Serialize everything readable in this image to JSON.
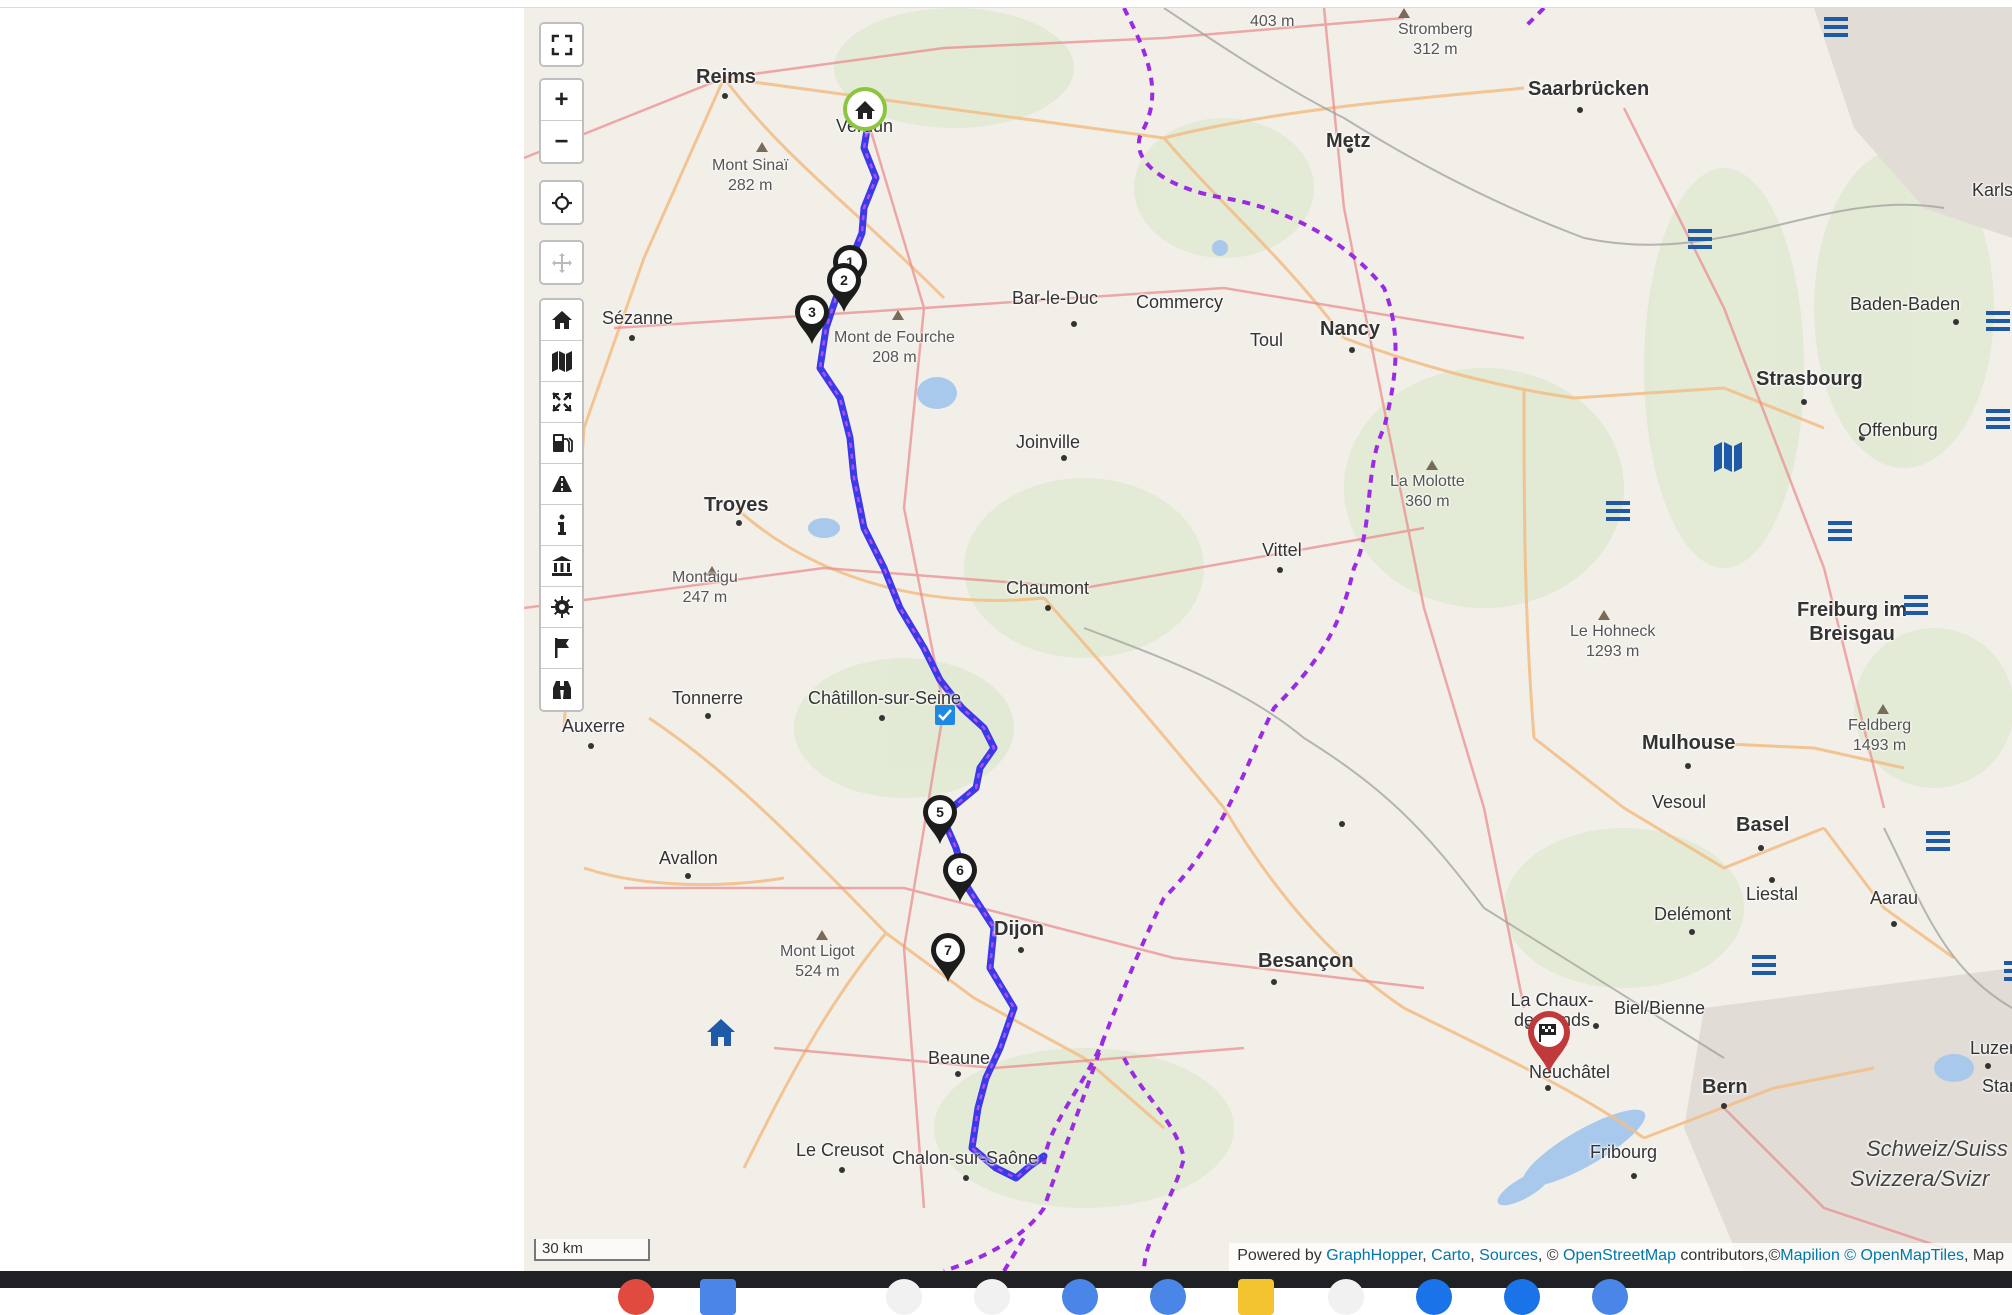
{
  "map": {
    "cities": [
      {
        "name": "Reims",
        "big": true
      },
      {
        "name": "Metz",
        "big": true
      },
      {
        "name": "Saarbrücken",
        "big": true
      },
      {
        "name": "Verdun",
        "big": false
      },
      {
        "name": "Sézanne",
        "big": false
      },
      {
        "name": "Bar-le-Duc",
        "big": false
      },
      {
        "name": "Commercy",
        "big": false
      },
      {
        "name": "Toul",
        "big": false
      },
      {
        "name": "Nancy",
        "big": true
      },
      {
        "name": "Strasbourg",
        "big": true
      },
      {
        "name": "Baden-Baden",
        "big": false
      },
      {
        "name": "Offenburg",
        "big": false
      },
      {
        "name": "Karlsr",
        "big": false
      },
      {
        "name": "Joinville",
        "big": false
      },
      {
        "name": "Troyes",
        "big": true
      },
      {
        "name": "Vittel",
        "big": false
      },
      {
        "name": "Chaumont",
        "big": false
      },
      {
        "name": "Freiburg im Breisgau",
        "big": true
      },
      {
        "name": "Tonnerre",
        "big": false
      },
      {
        "name": "Châtillon-sur-Seine",
        "big": false
      },
      {
        "name": "Auxerre",
        "big": false
      },
      {
        "name": "Mulhouse",
        "big": true
      },
      {
        "name": "Vesoul",
        "big": false
      },
      {
        "name": "Avallon",
        "big": false
      },
      {
        "name": "Basel",
        "big": true
      },
      {
        "name": "Liestal",
        "big": false
      },
      {
        "name": "Delémont",
        "big": false
      },
      {
        "name": "Aarau",
        "big": false
      },
      {
        "name": "Dijon",
        "big": true
      },
      {
        "name": "Besançon",
        "big": true
      },
      {
        "name": "La Chaux-de-Fonds",
        "big": false
      },
      {
        "name": "Biel/Bienne",
        "big": false
      },
      {
        "name": "Beaune",
        "big": false
      },
      {
        "name": "Neuchâtel",
        "big": false
      },
      {
        "name": "Bern",
        "big": true
      },
      {
        "name": "Luzern",
        "big": false
      },
      {
        "name": "Stans",
        "big": false
      },
      {
        "name": "Le Creusot",
        "big": false
      },
      {
        "name": "Chalon-sur-Saône",
        "big": false
      },
      {
        "name": "Fribourg",
        "big": false
      },
      {
        "name": "Schweiz/Suiss",
        "big": false
      },
      {
        "name": "Svizzera/Svizr",
        "big": false
      }
    ],
    "peaks": [
      {
        "name": "Mont Sinaï",
        "elev": "282 m"
      },
      {
        "name": "Mont de Fourche",
        "elev": "208 m"
      },
      {
        "name": "Montaigu",
        "elev": "247 m"
      },
      {
        "name": "La Molotte",
        "elev": "360 m"
      },
      {
        "name": "Le Hohneck",
        "elev": "1293 m"
      },
      {
        "name": "Feldberg",
        "elev": "1493 m"
      },
      {
        "name": "Mont Ligot",
        "elev": "524 m"
      },
      {
        "name": "Stromberg",
        "elev": "312 m"
      },
      {
        "name": "",
        "elev": "403 m"
      }
    ],
    "waypoints": [
      "1",
      "2",
      "3",
      "5",
      "6",
      "7"
    ],
    "route_color": "#3a3ae8",
    "route_dash_color": "#b04ff0",
    "border_color": "#9a2be2"
  },
  "controls": {
    "fullscreen_icon": "fullscreen-icon",
    "zoom_in_label": "+",
    "zoom_out_label": "−",
    "toolbar_icons": [
      "home-icon",
      "map-icon",
      "expand-icon",
      "fuel-icon",
      "road-icon",
      "info-icon",
      "museum-icon",
      "settings-icon",
      "flag-icon",
      "binoculars-icon"
    ]
  },
  "scale": {
    "label": "30 km"
  },
  "attribution": {
    "prefix": "Powered by",
    "graphhopper": "GraphHopper",
    "carto": "Carto",
    "sources": "Sources",
    "osm_prefix": "©",
    "osm": "OpenStreetMap",
    "contrib": "contributors,©",
    "mapilion": "Mapilion",
    "omt": "© OpenMapTiles",
    "tail": ", Map"
  }
}
